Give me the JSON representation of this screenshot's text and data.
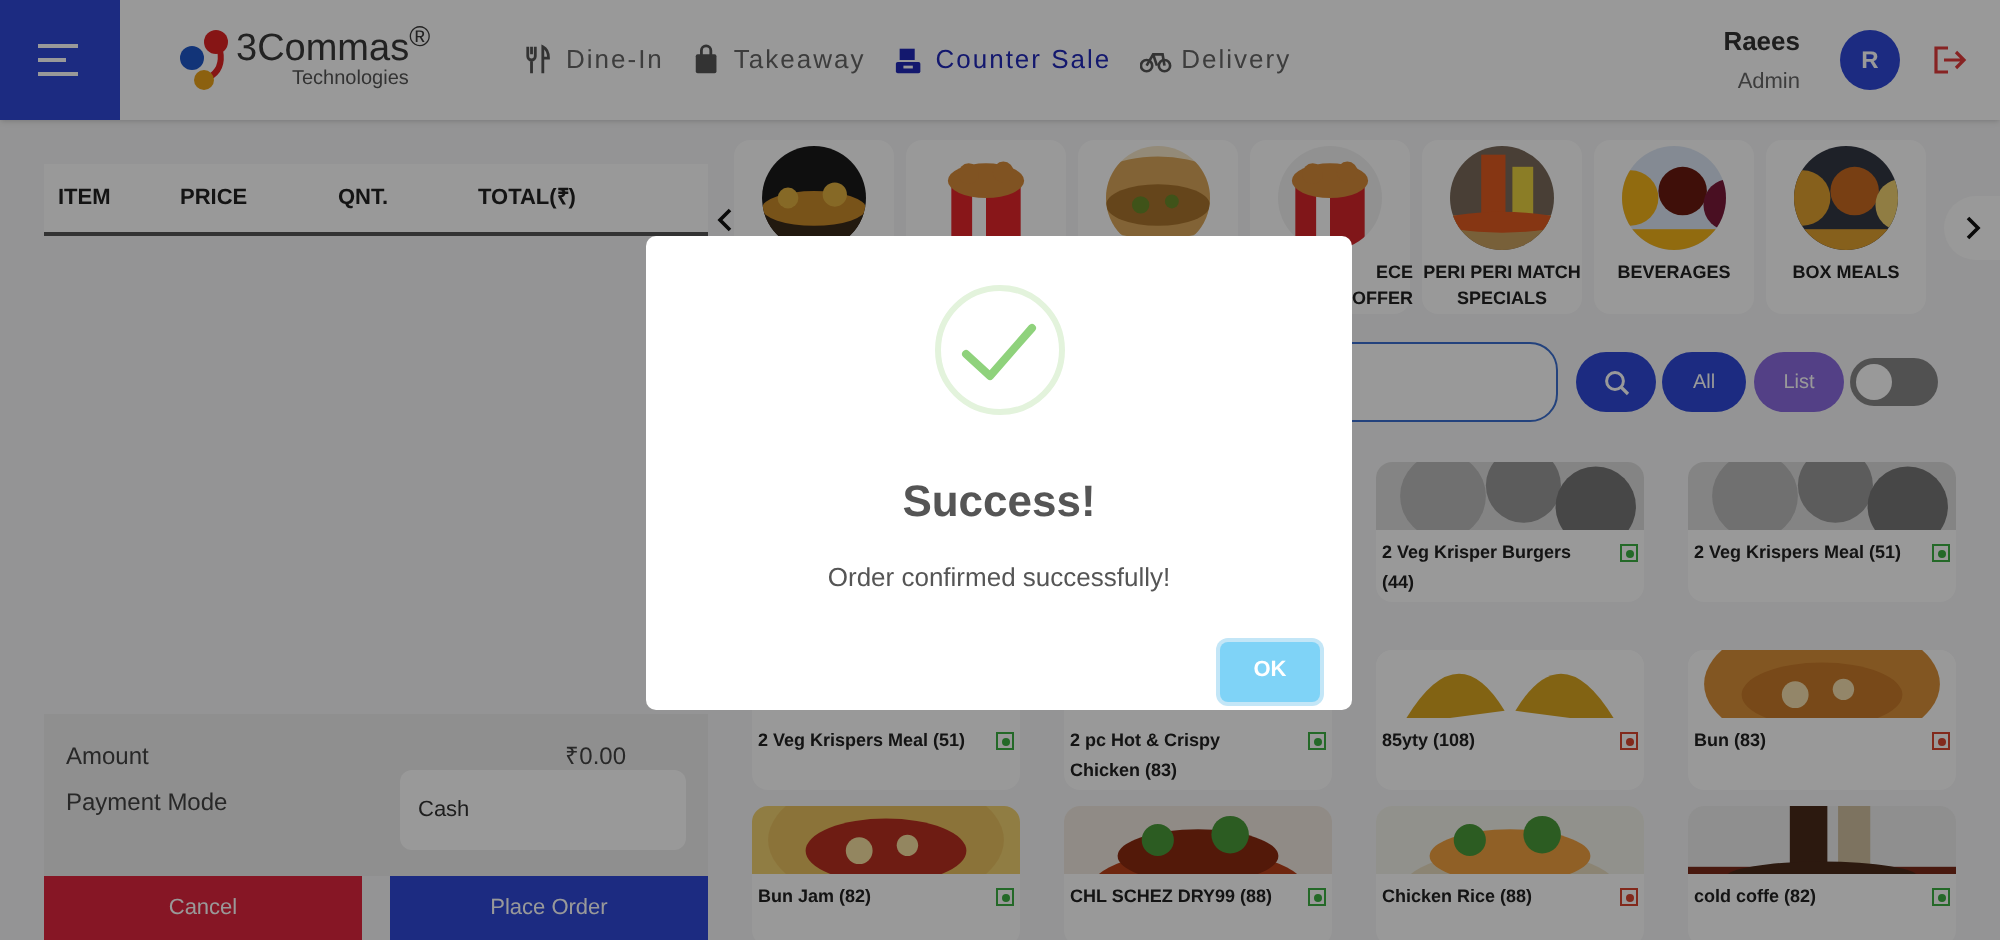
{
  "header": {
    "logo_text": "3Commas$^{®}$",
    "logo_subtext": "Technologies",
    "nav_tabs": [
      {
        "label": "Dine-In",
        "selected": false
      },
      {
        "label": "Takeaway",
        "selected": false
      },
      {
        "label": "Counter Sale",
        "selected": true
      },
      {
        "label": "Delivery",
        "selected": false
      }
    ],
    "user": {
      "name": "Raees",
      "role": "Admin",
      "avatar": "R"
    }
  },
  "order_table": {
    "columns": [
      "ITEM",
      "PRICE",
      "QNT.",
      "TOTAL(₹)"
    ]
  },
  "summary": {
    "amount_label": "Amount",
    "amount": "₹0.00",
    "payment_label": "Payment Mode",
    "payment_mode": "Cash"
  },
  "actions": [
    "Cancel",
    "Place Order"
  ],
  "categories": [
    {
      "kind": "picture"
    },
    {
      "kind": "picture"
    },
    {
      "kind": "picture"
    },
    {
      "kind": "picture",
      "label_lines": [
        "ECE",
        "OFFER"
      ]
    },
    {
      "kind": "picture",
      "label_lines": [
        "PERI PERI MATCH",
        "SPECIALS"
      ]
    },
    {
      "kind": "picture",
      "label_lines": [
        "BEVERAGES"
      ]
    },
    {
      "kind": "picture",
      "label_lines": [
        "BOX MEALS"
      ]
    }
  ],
  "search": {
    "view_buttons": [
      "All",
      "List"
    ],
    "toggle_on": false
  },
  "product_rows": [
    [
      {
        "name": "2 Veg Krisper Burgers (44)",
        "veg": true,
        "kind": "picture"
      },
      {
        "name": "2 Veg Krispers Meal (51)",
        "veg": true,
        "kind": "picture"
      }
    ],
    [
      {
        "name": "2 Veg Krispers Meal (51)",
        "veg": true
      },
      {
        "name": "2 pc Hot & Crispy Chicken (83)",
        "veg": true
      },
      {
        "name": "85yty (108)",
        "veg": false,
        "kind": "picture"
      },
      {
        "name": "Bun (83)",
        "veg": false,
        "kind": "picture"
      }
    ],
    [
      {
        "name": "Bun Jam (82)",
        "veg": true,
        "kind": "picture"
      },
      {
        "name": "CHL SCHEZ DRY99 (88)",
        "veg": true,
        "kind": "picture"
      },
      {
        "name": "Chicken Rice (88)",
        "veg": false,
        "kind": "picture"
      },
      {
        "name": "cold coffe (82)",
        "veg": true,
        "kind": "picture"
      }
    ]
  ],
  "dialog": {
    "title": "Success!",
    "message": "Order confirmed successfully!",
    "button": "OK"
  }
}
